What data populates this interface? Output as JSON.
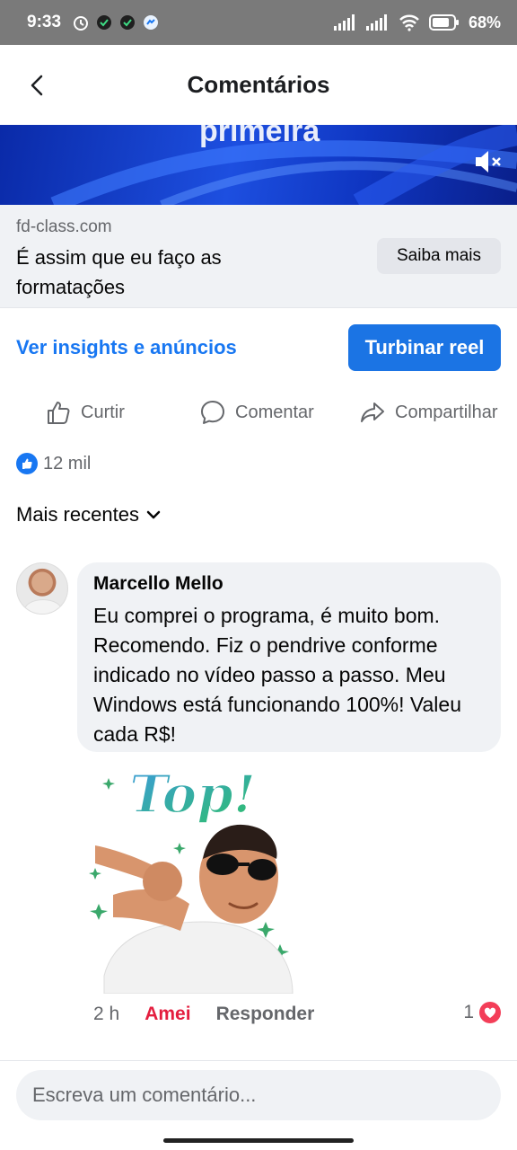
{
  "status_bar": {
    "time": "9:33",
    "battery": "68%"
  },
  "header": {
    "title": "Comentários",
    "back_icon": "chevron-left-icon"
  },
  "video": {
    "overlay_text": "primeira",
    "mute_icon": "volume-muted-icon"
  },
  "ad": {
    "domain": "fd-class.com",
    "headline": "É assim que eu faço as formatações",
    "cta_label": "Saiba mais"
  },
  "insights": {
    "link_label": "Ver insights e anúncios",
    "boost_label": "Turbinar reel"
  },
  "actions": [
    {
      "label": "Curtir",
      "icon": "thumbs-up-icon"
    },
    {
      "label": "Comentar",
      "icon": "comment-icon"
    },
    {
      "label": "Compartilhar",
      "icon": "share-icon"
    }
  ],
  "reactions": {
    "count": "12 mil",
    "icon": "like-badge-icon"
  },
  "sort": {
    "label": "Mais recentes",
    "icon": "chevron-down-icon"
  },
  "comment": {
    "author": "Marcello Mello",
    "text": "Eu comprei o programa, é muito bom. Recomendo. Fiz o pendrive conforme indicado no vídeo passo a passo. Meu Windows está funcionando 100%! Valeu cada R$!",
    "sticker_text": "Top!",
    "time": "2 h",
    "reaction_label": "Amei",
    "reply_label": "Responder",
    "reaction_count": "1"
  },
  "composer": {
    "placeholder": "Escreva um comentário..."
  },
  "colors": {
    "accent": "#1877f2",
    "love": "#e41e3f",
    "bubble": "#f0f2f5",
    "muted": "#65676b"
  }
}
